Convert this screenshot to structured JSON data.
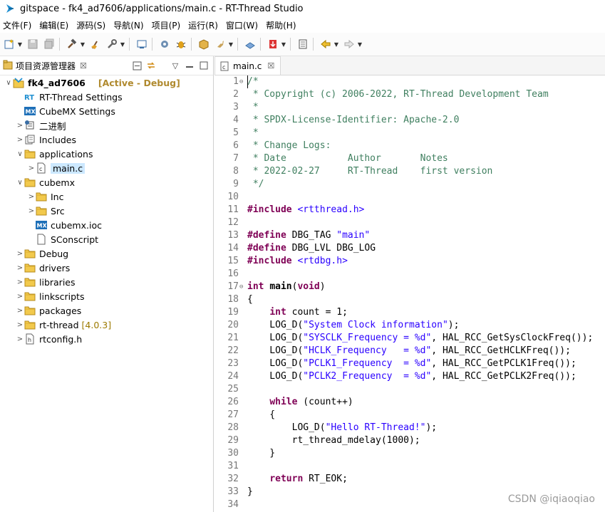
{
  "window": {
    "title": "gitspace - fk4_ad7606/applications/main.c - RT-Thread Studio"
  },
  "menu": [
    "文件(F)",
    "编辑(E)",
    "源码(S)",
    "导航(N)",
    "项目(P)",
    "运行(R)",
    "窗口(W)",
    "帮助(H)"
  ],
  "explorer": {
    "tab_label": "项目资源管理器",
    "close_glyph": "☒",
    "tree": [
      {
        "label": "fk4_ad7606",
        "meta": "[Active - Debug]",
        "depth": 0,
        "twisty": "∨",
        "icon": "project-icon",
        "bold": true
      },
      {
        "label": "RT-Thread Settings",
        "depth": 1,
        "twisty": "",
        "icon": "rt-settings-icon"
      },
      {
        "label": "CubeMX Settings",
        "depth": 1,
        "twisty": "",
        "icon": "mx-icon"
      },
      {
        "label": "二进制",
        "depth": 1,
        "twisty": ">",
        "icon": "binary-icon"
      },
      {
        "label": "Includes",
        "depth": 1,
        "twisty": ">",
        "icon": "includes-icon"
      },
      {
        "label": "applications",
        "depth": 1,
        "twisty": "∨",
        "icon": "folder-icon"
      },
      {
        "label": "main.c",
        "depth": 2,
        "twisty": ">",
        "icon": "c-file-icon",
        "selected": true
      },
      {
        "label": "cubemx",
        "depth": 1,
        "twisty": "∨",
        "icon": "folder-icon"
      },
      {
        "label": "Inc",
        "depth": 2,
        "twisty": ">",
        "icon": "folder-icon"
      },
      {
        "label": "Src",
        "depth": 2,
        "twisty": ">",
        "icon": "folder-icon"
      },
      {
        "label": "cubemx.ioc",
        "depth": 2,
        "twisty": "",
        "icon": "mx-icon"
      },
      {
        "label": "SConscript",
        "depth": 2,
        "twisty": "",
        "icon": "file-icon"
      },
      {
        "label": "Debug",
        "depth": 1,
        "twisty": ">",
        "icon": "folder-icon"
      },
      {
        "label": "drivers",
        "depth": 1,
        "twisty": ">",
        "icon": "folder-icon"
      },
      {
        "label": "libraries",
        "depth": 1,
        "twisty": ">",
        "icon": "folder-icon"
      },
      {
        "label": "linkscripts",
        "depth": 1,
        "twisty": ">",
        "icon": "folder-icon"
      },
      {
        "label": "packages",
        "depth": 1,
        "twisty": ">",
        "icon": "folder-icon"
      },
      {
        "label": "rt-thread",
        "ext": "[4.0.3]",
        "depth": 1,
        "twisty": ">",
        "icon": "folder-icon"
      },
      {
        "label": "rtconfig.h",
        "depth": 1,
        "twisty": ">",
        "icon": "h-file-icon"
      }
    ]
  },
  "editor": {
    "tab_label": "main.c",
    "close_glyph": "☒",
    "lines": [
      {
        "n": "1",
        "fold": "⊖",
        "parts": [
          {
            "t": "/*",
            "c": "cmt"
          }
        ]
      },
      {
        "n": "2",
        "parts": [
          {
            "t": " * Copyright (c) 2006-2022, RT-Thread Development Team",
            "c": "cmt"
          }
        ]
      },
      {
        "n": "3",
        "parts": [
          {
            "t": " *",
            "c": "cmt"
          }
        ]
      },
      {
        "n": "4",
        "parts": [
          {
            "t": " * SPDX-License-Identifier: Apache-2.0",
            "c": "cmt"
          }
        ]
      },
      {
        "n": "5",
        "parts": [
          {
            "t": " *",
            "c": "cmt"
          }
        ]
      },
      {
        "n": "6",
        "parts": [
          {
            "t": " * Change Logs:",
            "c": "cmt"
          }
        ]
      },
      {
        "n": "7",
        "parts": [
          {
            "t": " * Date           Author       Notes",
            "c": "cmt"
          }
        ]
      },
      {
        "n": "8",
        "parts": [
          {
            "t": " * 2022-02-27     RT-Thread    first version",
            "c": "cmt"
          }
        ]
      },
      {
        "n": "9",
        "parts": [
          {
            "t": " */",
            "c": "cmt"
          }
        ]
      },
      {
        "n": "10",
        "parts": []
      },
      {
        "n": "11",
        "parts": [
          {
            "t": "#include",
            "c": "kw"
          },
          {
            "t": " "
          },
          {
            "t": "<rtthread.h>",
            "c": "inc"
          }
        ]
      },
      {
        "n": "12",
        "parts": []
      },
      {
        "n": "13",
        "parts": [
          {
            "t": "#define",
            "c": "kw"
          },
          {
            "t": " DBG_TAG "
          },
          {
            "t": "\"main\"",
            "c": "str"
          }
        ]
      },
      {
        "n": "14",
        "parts": [
          {
            "t": "#define",
            "c": "kw"
          },
          {
            "t": " DBG_LVL DBG_LOG"
          }
        ]
      },
      {
        "n": "15",
        "parts": [
          {
            "t": "#include",
            "c": "kw"
          },
          {
            "t": " "
          },
          {
            "t": "<rtdbg.h>",
            "c": "inc"
          }
        ]
      },
      {
        "n": "16",
        "parts": []
      },
      {
        "n": "17",
        "fold": "⊖",
        "parts": [
          {
            "t": "int",
            "c": "kw"
          },
          {
            "t": " "
          },
          {
            "t": "main",
            "c": "bold"
          },
          {
            "t": "("
          },
          {
            "t": "void",
            "c": "kw"
          },
          {
            "t": ")"
          }
        ]
      },
      {
        "n": "18",
        "parts": [
          {
            "t": "{"
          }
        ]
      },
      {
        "n": "19",
        "parts": [
          {
            "t": "    "
          },
          {
            "t": "int",
            "c": "kw"
          },
          {
            "t": " count = 1;"
          }
        ]
      },
      {
        "n": "20",
        "parts": [
          {
            "t": "    LOG_D("
          },
          {
            "t": "\"System Clock information\"",
            "c": "str"
          },
          {
            "t": ");"
          }
        ]
      },
      {
        "n": "21",
        "parts": [
          {
            "t": "    LOG_D("
          },
          {
            "t": "\"SYSCLK_Frequency = %d\"",
            "c": "str"
          },
          {
            "t": ", HAL_RCC_GetSysClockFreq());"
          }
        ]
      },
      {
        "n": "22",
        "parts": [
          {
            "t": "    LOG_D("
          },
          {
            "t": "\"HCLK_Frequency   = %d\"",
            "c": "str"
          },
          {
            "t": ", HAL_RCC_GetHCLKFreq());"
          }
        ]
      },
      {
        "n": "23",
        "parts": [
          {
            "t": "    LOG_D("
          },
          {
            "t": "\"PCLK1_Frequency  = %d\"",
            "c": "str"
          },
          {
            "t": ", HAL_RCC_GetPCLK1Freq());"
          }
        ]
      },
      {
        "n": "24",
        "parts": [
          {
            "t": "    LOG_D("
          },
          {
            "t": "\"PCLK2_Frequency  = %d\"",
            "c": "str"
          },
          {
            "t": ", HAL_RCC_GetPCLK2Freq());"
          }
        ]
      },
      {
        "n": "25",
        "parts": []
      },
      {
        "n": "26",
        "parts": [
          {
            "t": "    "
          },
          {
            "t": "while",
            "c": "kw"
          },
          {
            "t": " (count++)"
          }
        ]
      },
      {
        "n": "27",
        "parts": [
          {
            "t": "    {"
          }
        ]
      },
      {
        "n": "28",
        "parts": [
          {
            "t": "        LOG_D("
          },
          {
            "t": "\"Hello RT-Thread!\"",
            "c": "str"
          },
          {
            "t": ");"
          }
        ]
      },
      {
        "n": "29",
        "parts": [
          {
            "t": "        rt_thread_mdelay(1000);"
          }
        ]
      },
      {
        "n": "30",
        "parts": [
          {
            "t": "    }"
          }
        ]
      },
      {
        "n": "31",
        "parts": []
      },
      {
        "n": "32",
        "parts": [
          {
            "t": "    "
          },
          {
            "t": "return",
            "c": "kw"
          },
          {
            "t": " RT_EOK;"
          }
        ]
      },
      {
        "n": "33",
        "parts": [
          {
            "t": "}"
          }
        ]
      },
      {
        "n": "34",
        "parts": []
      }
    ]
  },
  "watermark": "CSDN @iqiaoqiao",
  "colors": {
    "comment": "#3f7f5f",
    "keyword": "#7f0055",
    "string": "#2a00ff",
    "selection": "#cce8ff",
    "meta": "#b08a2f"
  }
}
